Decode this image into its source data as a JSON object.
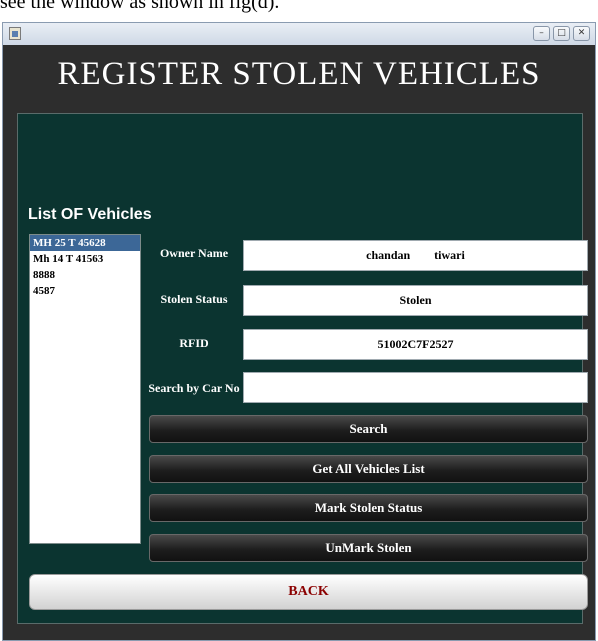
{
  "caption": "see the window as shown in fig(d).",
  "window": {
    "controls": {
      "minimize": "–",
      "maximize": "□",
      "close": "✕"
    },
    "icon": "java-app-icon"
  },
  "header": {
    "title": "REGISTER STOLEN VEHICLES"
  },
  "vehicle_list": {
    "title": "List OF Vehicles",
    "items": [
      "MH 25 T 45628",
      "Mh 14 T 41563",
      "8888",
      "4587"
    ],
    "selected_index": 0
  },
  "form": {
    "owner_name": {
      "label": "Owner Name",
      "value": "chandan        tiwari"
    },
    "stolen_status": {
      "label": "Stolen Status",
      "value": "Stolen"
    },
    "rfid": {
      "label": "RFID",
      "value": "51002C7F2527"
    },
    "search_car_no": {
      "label": "Search by Car No",
      "value": ""
    }
  },
  "buttons": {
    "search": "Search",
    "get_all": "Get All Vehicles List",
    "mark_stolen": "Mark Stolen Status",
    "unmark_stolen": "UnMark Stolen",
    "back": "BACK"
  },
  "colors": {
    "panel_bg": "#0b3430",
    "header_bg": "#2d2d2d",
    "selection": "#3c6797",
    "back_text": "#8b0000"
  }
}
